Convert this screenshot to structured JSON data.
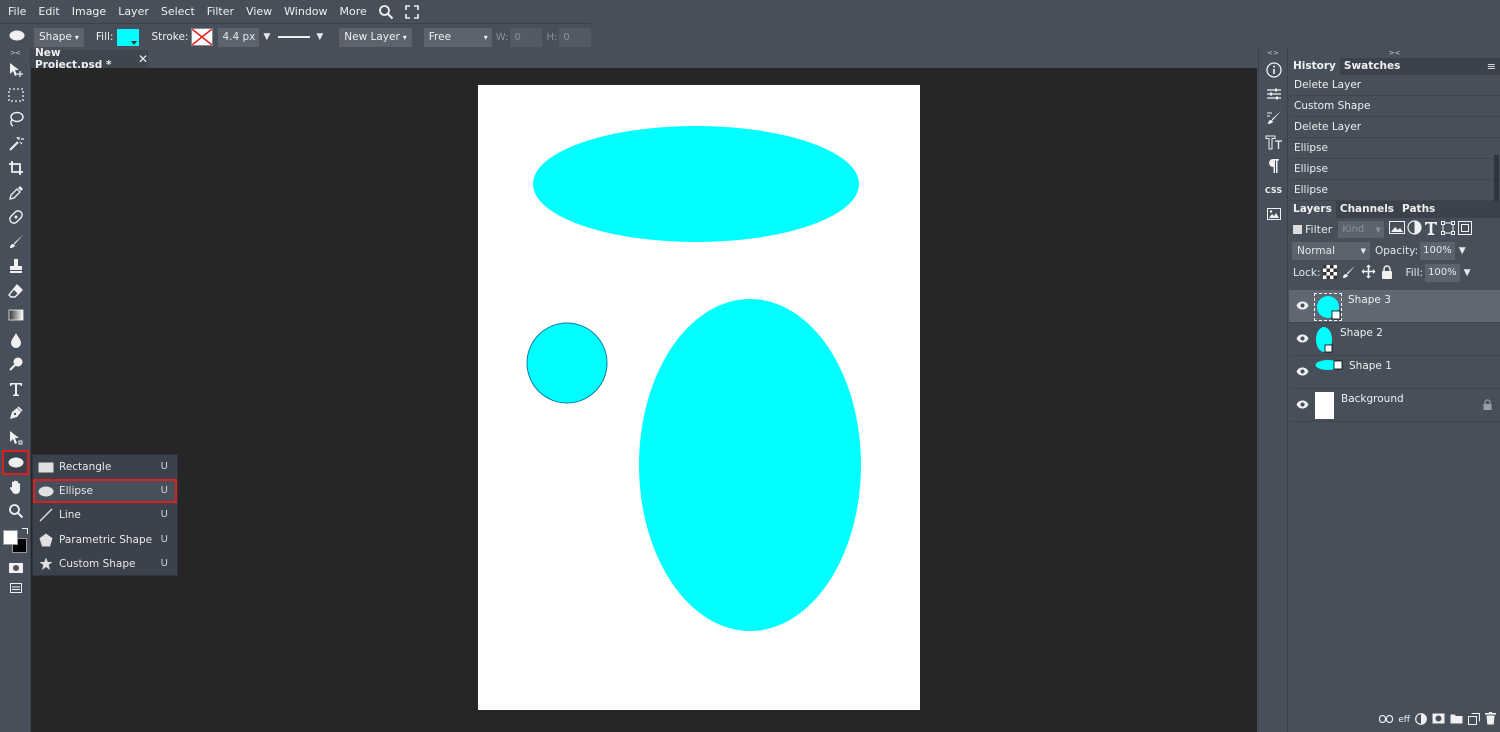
{
  "menu": [
    "File",
    "Edit",
    "Image",
    "Layer",
    "Select",
    "Filter",
    "View",
    "Window",
    "More"
  ],
  "options": {
    "shape_mode": "Shape",
    "fill_label": "Fill:",
    "fill_color": "#00ffff",
    "stroke_label": "Stroke:",
    "stroke_width": "4.4 px",
    "layer_mode": "New Layer",
    "constraint": "Free",
    "w_label": "W:",
    "w_value": "0",
    "h_label": "H:",
    "h_value": "0"
  },
  "document": {
    "tab_title": "New Project.psd *"
  },
  "flyout": [
    {
      "label": "Rectangle",
      "key": "U",
      "icon": "rectangle-icon"
    },
    {
      "label": "Ellipse",
      "key": "U",
      "icon": "ellipse-icon",
      "selected": true
    },
    {
      "label": "Line",
      "key": "U",
      "icon": "line-icon"
    },
    {
      "label": "Parametric Shape",
      "key": "U",
      "icon": "pentagon-icon"
    },
    {
      "label": "Custom Shape",
      "key": "U",
      "icon": "star-icon"
    }
  ],
  "history": {
    "tabs": [
      "History",
      "Swatches"
    ],
    "items": [
      "Delete Layer",
      "Custom Shape",
      "Delete Layer",
      "Ellipse",
      "Ellipse",
      "Ellipse"
    ]
  },
  "layers_panel": {
    "tabs": [
      "Layers",
      "Channels",
      "Paths"
    ],
    "filter_label": "Filter",
    "kind_placeholder": "Kind",
    "blend_mode": "Normal",
    "opacity_label": "Opacity:",
    "opacity": "100%",
    "lock_label": "Lock:",
    "fill_label": "Fill:",
    "fill": "100%",
    "layers": [
      {
        "name": "Shape 3",
        "selected": true
      },
      {
        "name": "Shape 2"
      },
      {
        "name": "Shape 1"
      },
      {
        "name": "Background",
        "locked": true
      }
    ]
  },
  "footer_labels": {
    "effects": "eff"
  },
  "ministrip_labels": {
    "css": "CSS"
  },
  "colors": {
    "shape_fill": "#00ffff",
    "accent_highlight": "#d92020",
    "panel_bg": "#474f5b",
    "workspace_bg": "#262626"
  }
}
